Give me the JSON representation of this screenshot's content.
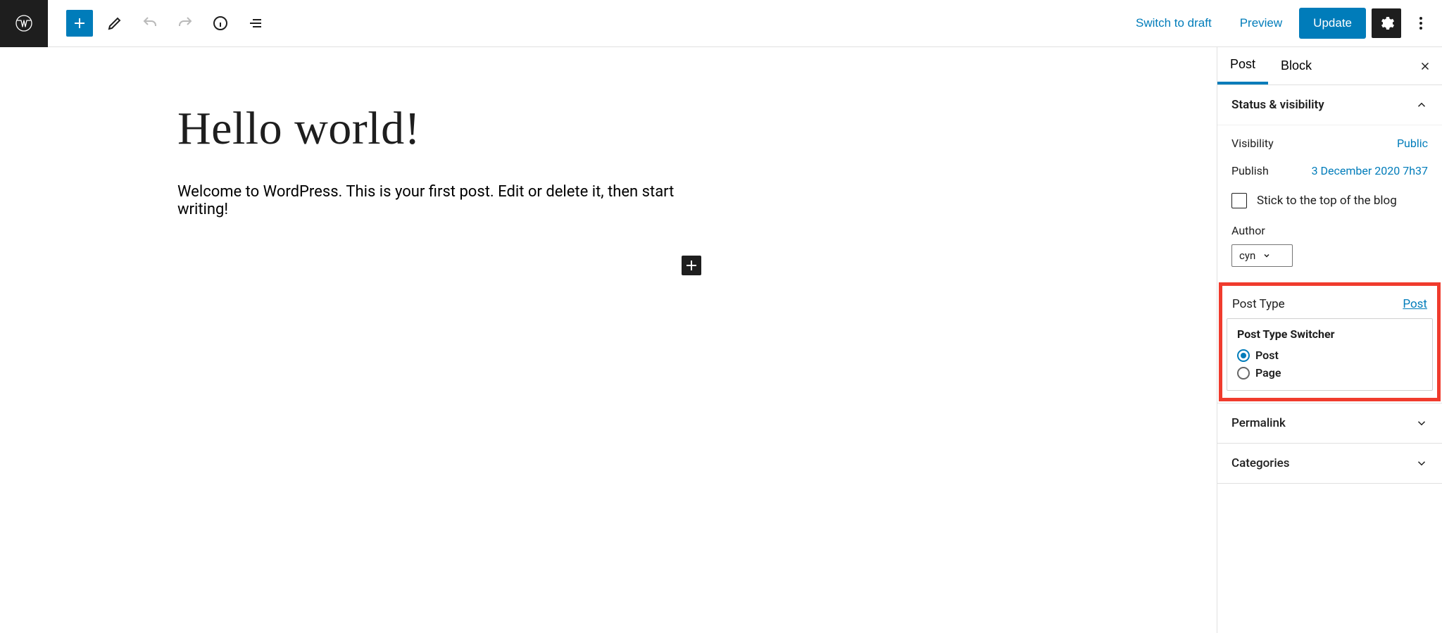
{
  "toolbar": {
    "switch_to_draft": "Switch to draft",
    "preview": "Preview",
    "update": "Update"
  },
  "editor": {
    "title": "Hello world!",
    "body": "Welcome to WordPress. This is your first post. Edit or delete it, then start writing!"
  },
  "sidebar": {
    "tabs": {
      "post": "Post",
      "block": "Block"
    },
    "panels": {
      "status_visibility": {
        "title": "Status & visibility",
        "visibility_label": "Visibility",
        "visibility_value": "Public",
        "publish_label": "Publish",
        "publish_value": "3 December 2020 7h37",
        "stick_label": "Stick to the top of the blog",
        "author_label": "Author",
        "author_value": "cyn"
      },
      "post_type": {
        "title": "Post Type",
        "link": "Post",
        "switcher_title": "Post Type Switcher",
        "option_post": "Post",
        "option_page": "Page"
      },
      "permalink": "Permalink",
      "categories": "Categories"
    }
  }
}
